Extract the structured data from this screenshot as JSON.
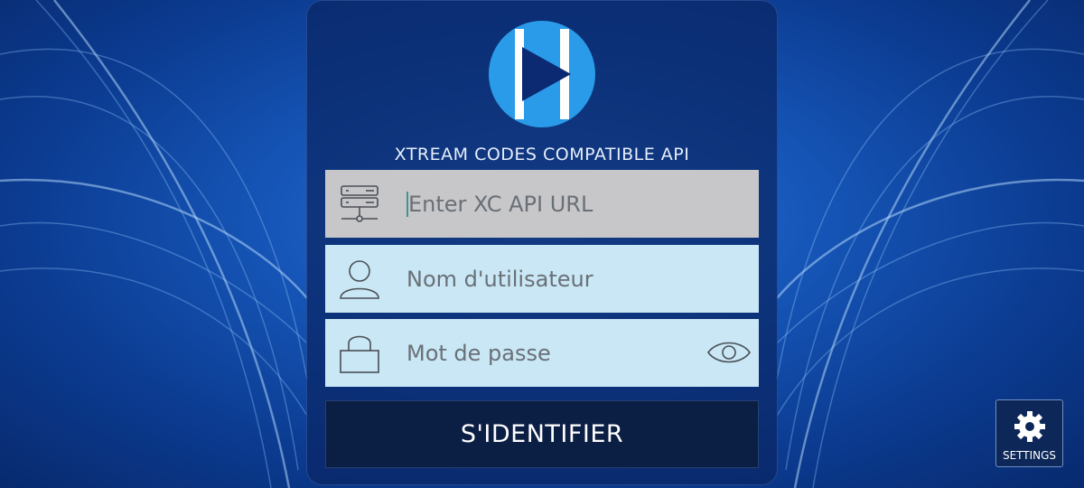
{
  "app": {
    "subtitle": "XTREAM CODES COMPATIBLE API"
  },
  "form": {
    "url_placeholder": "Enter XC API URL",
    "username_placeholder": "Nom d'utilisateur",
    "password_placeholder": "Mot de passe",
    "login_label": "S'IDENTIFIER"
  },
  "settings": {
    "label": "SETTINGS"
  },
  "icons": {
    "logo": "play-logo-icon",
    "server": "server-icon",
    "user": "user-icon",
    "lock": "lock-icon",
    "eye": "eye-icon",
    "gear": "gear-icon"
  },
  "colors": {
    "logo_blue": "#2a9be8",
    "url_field_bg": "#c7c7c9",
    "input_field_bg": "#c9e7f4",
    "login_bg": "#0b1e44"
  }
}
